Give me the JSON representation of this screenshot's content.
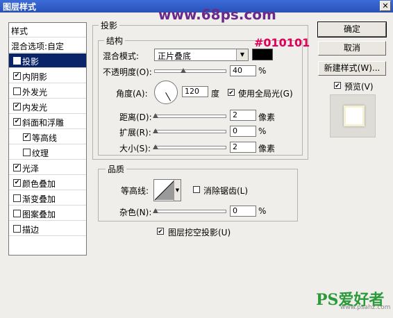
{
  "window": {
    "title": "图层样式",
    "close_label": "✕"
  },
  "watermark": "www.68ps.com",
  "left_panel": {
    "items": [
      {
        "label": "样式",
        "checkbox": false,
        "checked": false,
        "indent": 0,
        "selected": false
      },
      {
        "label": "混合选项:自定",
        "checkbox": false,
        "checked": false,
        "indent": 0,
        "selected": false
      },
      {
        "label": "投影",
        "checkbox": true,
        "checked": true,
        "indent": 0,
        "selected": true
      },
      {
        "label": "内阴影",
        "checkbox": true,
        "checked": true,
        "indent": 0,
        "selected": false
      },
      {
        "label": "外发光",
        "checkbox": true,
        "checked": false,
        "indent": 0,
        "selected": false
      },
      {
        "label": "内发光",
        "checkbox": true,
        "checked": true,
        "indent": 0,
        "selected": false
      },
      {
        "label": "斜面和浮雕",
        "checkbox": true,
        "checked": true,
        "indent": 0,
        "selected": false
      },
      {
        "label": "等高线",
        "checkbox": true,
        "checked": true,
        "indent": 1,
        "selected": false
      },
      {
        "label": "纹理",
        "checkbox": true,
        "checked": false,
        "indent": 1,
        "selected": false
      },
      {
        "label": "光泽",
        "checkbox": true,
        "checked": true,
        "indent": 0,
        "selected": false
      },
      {
        "label": "颜色叠加",
        "checkbox": true,
        "checked": true,
        "indent": 0,
        "selected": false
      },
      {
        "label": "渐变叠加",
        "checkbox": true,
        "checked": false,
        "indent": 0,
        "selected": false
      },
      {
        "label": "图案叠加",
        "checkbox": true,
        "checked": false,
        "indent": 0,
        "selected": false
      },
      {
        "label": "描边",
        "checkbox": true,
        "checked": false,
        "indent": 0,
        "selected": false
      }
    ]
  },
  "buttons": {
    "ok": "确定",
    "cancel": "取消",
    "new_style": "新建样式(W)...",
    "preview": "预览(V)"
  },
  "shadow": {
    "group_title": "投影",
    "structure_title": "结构",
    "blend_mode_label": "混合模式:",
    "blend_mode_value": "正片叠底",
    "color_hex": "#010101",
    "opacity_label": "不透明度(O):",
    "opacity_value": "40",
    "opacity_unit": "%",
    "opacity_level": 0.4,
    "angle_label": "角度(A):",
    "angle_value": "120",
    "angle_unit": "度",
    "global_light_label": "使用全局光(G)",
    "distance_label": "距离(D):",
    "distance_value": "2",
    "distance_unit": "像素",
    "spread_label": "扩展(R):",
    "spread_value": "0",
    "spread_unit": "%",
    "size_label": "大小(S):",
    "size_value": "2",
    "size_unit": "像素"
  },
  "quality": {
    "group_title": "品质",
    "contour_label": "等高线:",
    "antialias_label": "消除锯齿(L)",
    "noise_label": "杂色(N):",
    "noise_value": "0",
    "noise_unit": "%",
    "knockout_label": "图层挖空投影(U)"
  },
  "logo": {
    "text": "PS爱好者",
    "sub": "www.psahz.com"
  }
}
